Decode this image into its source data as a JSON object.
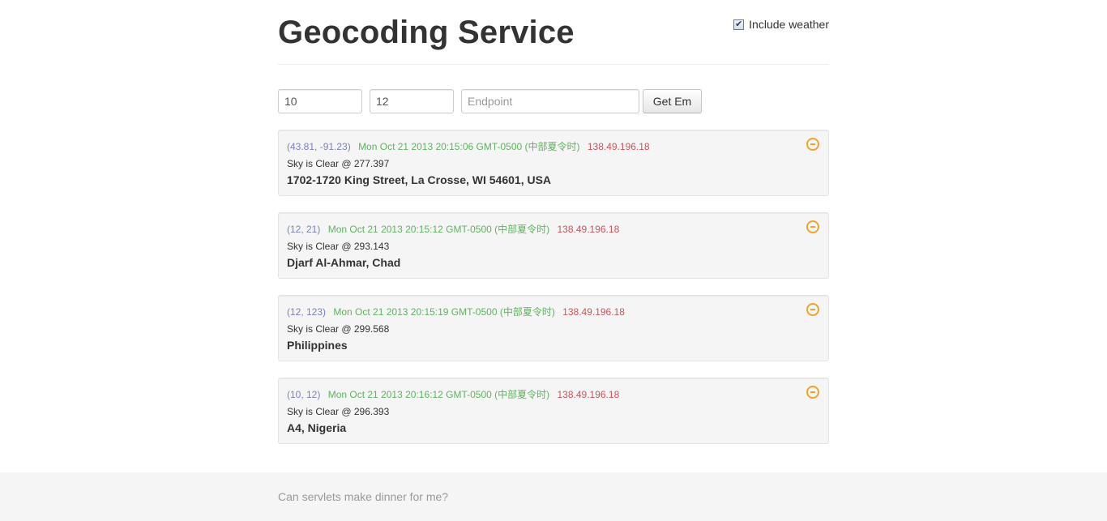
{
  "header": {
    "title": "Geocoding Service",
    "include_weather_label": "Include weather",
    "include_weather_checked": true
  },
  "form": {
    "lat_value": "10",
    "lng_value": "12",
    "endpoint_placeholder": "Endpoint",
    "submit_label": "Get Em"
  },
  "results": [
    {
      "coords": "(43.81, -91.23)",
      "time": "Mon Oct 21 2013 20:15:06 GMT-0500 (中部夏令时)",
      "ip": "138.49.196.18",
      "weather": "Sky is Clear @ 277.397",
      "address": "1702-1720 King Street, La Crosse, WI 54601, USA"
    },
    {
      "coords": "(12, 21)",
      "time": "Mon Oct 21 2013 20:15:12 GMT-0500 (中部夏令时)",
      "ip": "138.49.196.18",
      "weather": "Sky is Clear @ 293.143",
      "address": "Djarf Al-Ahmar, Chad"
    },
    {
      "coords": "(12, 123)",
      "time": "Mon Oct 21 2013 20:15:19 GMT-0500 (中部夏令时)",
      "ip": "138.49.196.18",
      "weather": "Sky is Clear @ 299.568",
      "address": "Philippines"
    },
    {
      "coords": "(10, 12)",
      "time": "Mon Oct 21 2013 20:16:12 GMT-0500 (中部夏令时)",
      "ip": "138.49.196.18",
      "weather": "Sky is Clear @ 296.393",
      "address": "A4, Nigeria"
    }
  ],
  "footer": {
    "text": "Can servlets make dinner for me?"
  },
  "icons": {
    "remove": "minus-circle-icon",
    "checkbox": "checkmark-icon"
  },
  "colors": {
    "coords": "#7b7fc4",
    "time": "#5fb35f",
    "ip": "#c9555a",
    "remove_icon": "#f0a32a"
  }
}
